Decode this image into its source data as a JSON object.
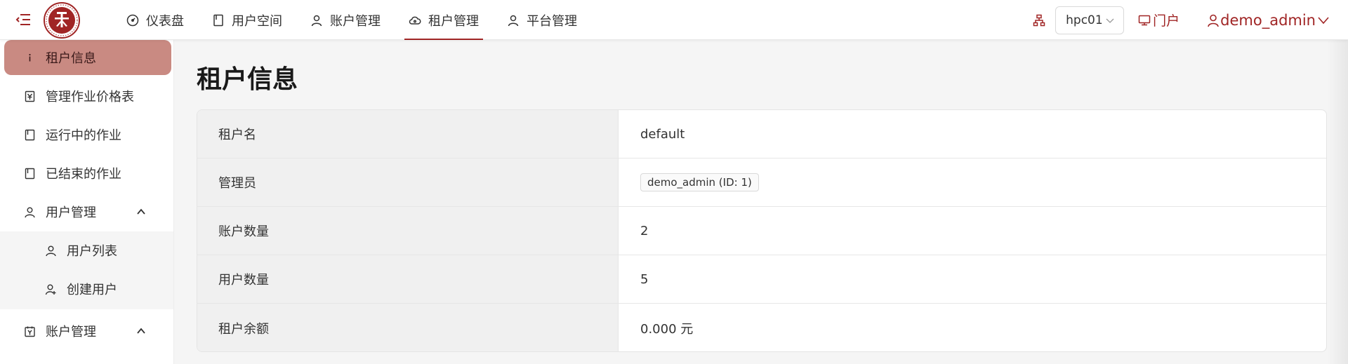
{
  "header": {
    "nav": [
      {
        "label": "仪表盘",
        "icon": "dashboard-icon"
      },
      {
        "label": "用户空间",
        "icon": "book-icon"
      },
      {
        "label": "账户管理",
        "icon": "user-icon"
      },
      {
        "label": "租户管理",
        "icon": "cloud-icon",
        "active": true
      },
      {
        "label": "平台管理",
        "icon": "user-icon"
      }
    ],
    "cluster": "hpc01",
    "portal_label": "门户",
    "user_name": "demo_admin"
  },
  "sidebar": {
    "items": [
      {
        "label": "租户信息",
        "icon": "info-icon",
        "active": true
      },
      {
        "label": "管理作业价格表",
        "icon": "price-icon"
      },
      {
        "label": "运行中的作业",
        "icon": "book-icon"
      },
      {
        "label": "已结束的作业",
        "icon": "book-icon"
      },
      {
        "label": "用户管理",
        "icon": "user-icon",
        "expanded": true
      },
      {
        "label": "用户列表",
        "icon": "user-icon"
      },
      {
        "label": "创建用户",
        "icon": "user-add-icon"
      },
      {
        "label": "账户管理",
        "icon": "account-book-icon",
        "expanded": true
      }
    ]
  },
  "main": {
    "title": "租户信息",
    "rows": [
      {
        "label": "租户名",
        "value": "default"
      },
      {
        "label": "管理员",
        "value": "demo_admin (ID: 1)"
      },
      {
        "label": "账户数量",
        "value": "2"
      },
      {
        "label": "用户数量",
        "value": "5"
      },
      {
        "label": "租户余额",
        "value": "0.000 元"
      }
    ]
  },
  "colors": {
    "accent": "#a02525",
    "sidebar_active": "#c98a82",
    "label_bg": "#f0f0f0"
  }
}
